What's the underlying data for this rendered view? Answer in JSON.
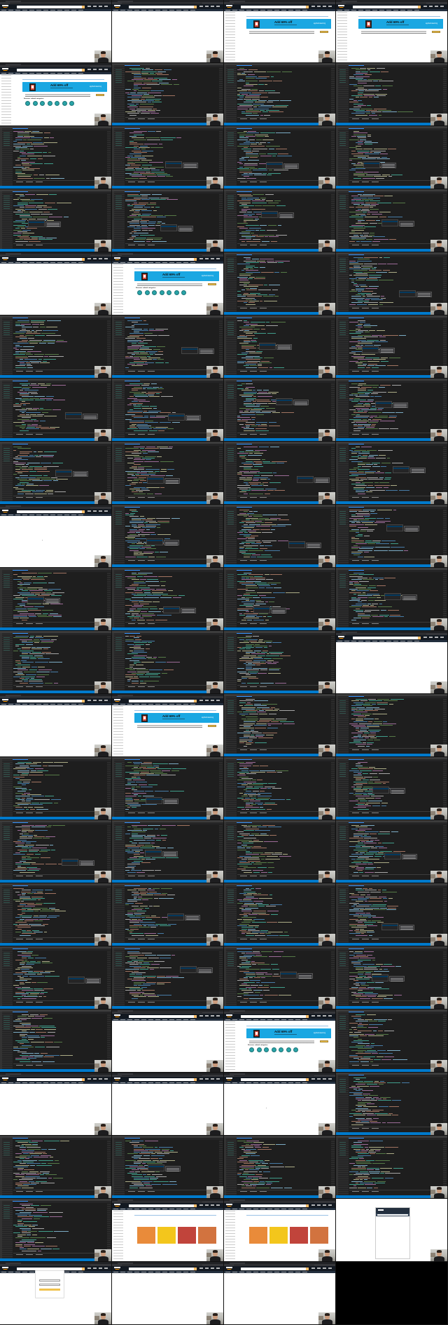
{
  "page": {
    "layout": "contact-sheet",
    "columns": 4,
    "frame_kinds_legend": [
      "ide",
      "browser",
      "mobile",
      "blank"
    ]
  },
  "browser": {
    "banner_offer": "Add 69% off",
    "banner_brand": "apphelmlearning",
    "section_label": "Discover related categories",
    "category_count": 7,
    "cover_colors": [
      "#e98b3a",
      "#f3c61c",
      "#c1443b",
      "#d2733f"
    ]
  },
  "ide": {
    "code_colors": [
      "#569cd6",
      "#9cdcfe",
      "#ce9178",
      "#dcdcaa",
      "#c586c0",
      "#6a9955",
      "#4ec9b0",
      "#d4d4d4"
    ],
    "panel_tabs": [
      "PROBLEMS",
      "OUTPUT",
      "TERMINAL"
    ]
  },
  "frames": [
    {
      "kind": "browser",
      "variant": "blank"
    },
    {
      "kind": "browser",
      "variant": "blank"
    },
    {
      "kind": "browser",
      "variant": "banner"
    },
    {
      "kind": "browser",
      "variant": "banner"
    },
    {
      "kind": "browser",
      "variant": "full"
    },
    {
      "kind": "ide",
      "seed": 1
    },
    {
      "kind": "ide",
      "seed": 2
    },
    {
      "kind": "ide",
      "seed": 3
    },
    {
      "kind": "ide",
      "seed": 4
    },
    {
      "kind": "ide",
      "seed": 5,
      "popup": true
    },
    {
      "kind": "ide",
      "seed": 6,
      "popup": true
    },
    {
      "kind": "ide",
      "seed": 7,
      "popup": true
    },
    {
      "kind": "ide",
      "seed": 8,
      "popup": true
    },
    {
      "kind": "ide",
      "seed": 9,
      "popup": true
    },
    {
      "kind": "ide",
      "seed": 10,
      "popup": true
    },
    {
      "kind": "ide",
      "seed": 11,
      "popup": true
    },
    {
      "kind": "browser",
      "variant": "blank"
    },
    {
      "kind": "browser",
      "variant": "full"
    },
    {
      "kind": "ide",
      "seed": 12
    },
    {
      "kind": "ide",
      "seed": 13,
      "popup": true
    },
    {
      "kind": "ide",
      "seed": 14
    },
    {
      "kind": "ide",
      "seed": 15,
      "popup": true
    },
    {
      "kind": "ide",
      "seed": 16,
      "popup": true
    },
    {
      "kind": "ide",
      "seed": 17,
      "popup": true
    },
    {
      "kind": "ide",
      "seed": 18,
      "popup": true
    },
    {
      "kind": "ide",
      "seed": 19,
      "popup": true
    },
    {
      "kind": "ide",
      "seed": 20,
      "popup": true
    },
    {
      "kind": "ide",
      "seed": 21,
      "popup": true
    },
    {
      "kind": "ide",
      "seed": 22,
      "popup": true
    },
    {
      "kind": "ide",
      "seed": 23,
      "popup": true
    },
    {
      "kind": "ide",
      "seed": 24,
      "popup": true
    },
    {
      "kind": "ide",
      "seed": 25,
      "popup": true
    },
    {
      "kind": "browser",
      "variant": "blank",
      "dot": true
    },
    {
      "kind": "ide",
      "seed": 26,
      "popup": true
    },
    {
      "kind": "ide",
      "seed": 27,
      "popup": true
    },
    {
      "kind": "ide",
      "seed": 28,
      "popup": true
    },
    {
      "kind": "ide",
      "seed": 29,
      "popup": true
    },
    {
      "kind": "ide",
      "seed": 30,
      "popup": true
    },
    {
      "kind": "ide",
      "seed": 31,
      "popup": true
    },
    {
      "kind": "ide",
      "seed": 32,
      "popup": true
    },
    {
      "kind": "ide",
      "seed": 33
    },
    {
      "kind": "ide",
      "seed": 34
    },
    {
      "kind": "ide",
      "seed": 35
    },
    {
      "kind": "browser",
      "variant": "blank"
    },
    {
      "kind": "browser",
      "variant": "blank"
    },
    {
      "kind": "browser",
      "variant": "banner"
    },
    {
      "kind": "ide",
      "seed": 36
    },
    {
      "kind": "ide",
      "seed": 37
    },
    {
      "kind": "ide",
      "seed": 38
    },
    {
      "kind": "ide",
      "seed": 39,
      "popup": true
    },
    {
      "kind": "ide",
      "seed": 40
    },
    {
      "kind": "ide",
      "seed": 41,
      "popup": true
    },
    {
      "kind": "ide",
      "seed": 42,
      "popup": true
    },
    {
      "kind": "ide",
      "seed": 43,
      "popup": true
    },
    {
      "kind": "ide",
      "seed": 44
    },
    {
      "kind": "ide",
      "seed": 45,
      "popup": true
    },
    {
      "kind": "ide",
      "seed": 46
    },
    {
      "kind": "ide",
      "seed": 47,
      "popup": true
    },
    {
      "kind": "ide",
      "seed": 48
    },
    {
      "kind": "ide",
      "seed": 49,
      "popup": true
    },
    {
      "kind": "ide",
      "seed": 50,
      "popup": true
    },
    {
      "kind": "ide",
      "seed": 51,
      "popup": true
    },
    {
      "kind": "ide",
      "seed": 52,
      "popup": true
    },
    {
      "kind": "ide",
      "seed": 53,
      "popup": true
    },
    {
      "kind": "ide",
      "seed": 54
    },
    {
      "kind": "browser",
      "variant": "blank"
    },
    {
      "kind": "browser",
      "variant": "full"
    },
    {
      "kind": "ide",
      "seed": 55
    },
    {
      "kind": "browser",
      "variant": "blank"
    },
    {
      "kind": "browser",
      "variant": "blank"
    },
    {
      "kind": "browser",
      "variant": "blank",
      "dot": true
    },
    {
      "kind": "ide",
      "seed": 56
    },
    {
      "kind": "ide",
      "seed": 57
    },
    {
      "kind": "ide",
      "seed": 58,
      "popup": true
    },
    {
      "kind": "ide",
      "seed": 59
    },
    {
      "kind": "ide",
      "seed": 60
    },
    {
      "kind": "ide",
      "seed": 61
    },
    {
      "kind": "browser",
      "variant": "books"
    },
    {
      "kind": "browser",
      "variant": "books"
    },
    {
      "kind": "mobile"
    },
    {
      "kind": "browser",
      "variant": "login"
    },
    {
      "kind": "browser",
      "variant": "blank"
    },
    {
      "kind": "browser",
      "variant": "blank"
    },
    {
      "kind": "blank"
    }
  ]
}
